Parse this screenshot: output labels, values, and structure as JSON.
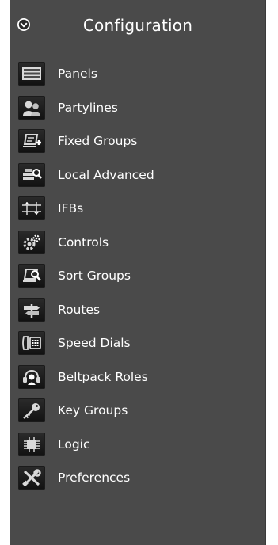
{
  "header": {
    "title": "Configuration",
    "collapse_icon": "chevron-down-circle-icon"
  },
  "menu": {
    "items": [
      {
        "label": "Panels",
        "icon": "panels-icon"
      },
      {
        "label": "Partylines",
        "icon": "partylines-icon"
      },
      {
        "label": "Fixed Groups",
        "icon": "fixed-groups-icon"
      },
      {
        "label": "Local Advanced",
        "icon": "local-advanced-icon"
      },
      {
        "label": "IFBs",
        "icon": "ifbs-icon"
      },
      {
        "label": "Controls",
        "icon": "controls-icon"
      },
      {
        "label": "Sort Groups",
        "icon": "sort-groups-icon"
      },
      {
        "label": "Routes",
        "icon": "routes-icon"
      },
      {
        "label": "Speed Dials",
        "icon": "speed-dials-icon"
      },
      {
        "label": "Beltpack Roles",
        "icon": "beltpack-roles-icon"
      },
      {
        "label": "Key Groups",
        "icon": "key-groups-icon"
      },
      {
        "label": "Logic",
        "icon": "logic-icon"
      },
      {
        "label": "Preferences",
        "icon": "preferences-icon"
      }
    ]
  }
}
